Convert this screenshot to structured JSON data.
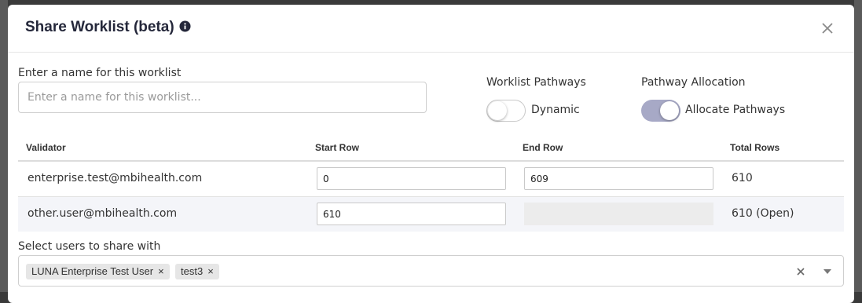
{
  "modal": {
    "title": "Share Worklist (beta)",
    "info_icon": "info-circle-icon",
    "close_icon": "close-icon"
  },
  "name_field": {
    "label": "Enter a name for this worklist",
    "placeholder": "Enter a name for this worklist...",
    "value": ""
  },
  "worklist_pathways": {
    "label": "Worklist Pathways",
    "toggle_label": "Dynamic",
    "checked": false
  },
  "pathway_allocation": {
    "label": "Pathway Allocation",
    "toggle_label": "Allocate Pathways",
    "checked": true
  },
  "table": {
    "headers": {
      "validator": "Validator",
      "start_row": "Start Row",
      "end_row": "End Row",
      "total_rows": "Total Rows"
    },
    "rows": [
      {
        "validator": "enterprise.test@mbihealth.com",
        "start_row": "0",
        "end_row": "609",
        "total_rows": "610"
      },
      {
        "validator": "other.user@mbihealth.com",
        "start_row": "610",
        "end_row": "",
        "total_rows": "610 (Open)"
      }
    ]
  },
  "share_users": {
    "label": "Select users to share with",
    "selected": [
      "LUNA Enterprise Test User",
      "test3"
    ],
    "chip_remove": "×",
    "clear_icon": "clear-x-icon",
    "dropdown_icon": "caret-down-icon"
  },
  "colors": {
    "title": "#24273a",
    "toggle_on": "#a7a9c6",
    "row_alt": "#f4f5f9",
    "chip": "#e6e6e6"
  }
}
